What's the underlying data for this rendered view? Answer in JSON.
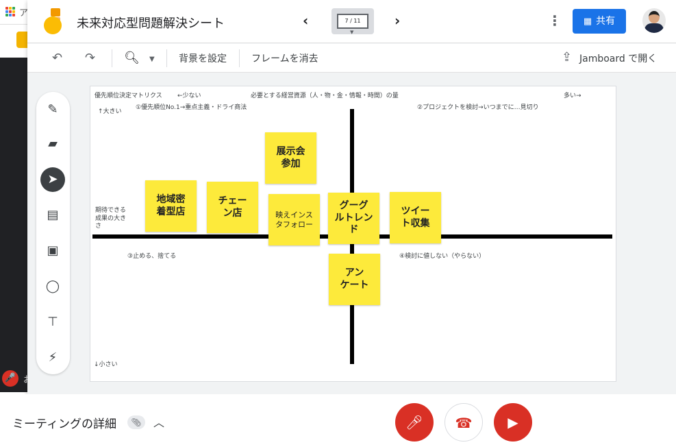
{
  "browser": {
    "tab_char": "ア"
  },
  "meet": {
    "participant_char": "お"
  },
  "jamboard": {
    "title": "未来対応型問題解決シート",
    "frame_counter": "7 / 11",
    "share_label": "共有",
    "toolbar": {
      "set_background": "背景を設定",
      "clear_frame": "フレームを消去",
      "open_in_jamboard": "Jamboard で開く"
    }
  },
  "canvas": {
    "labels": {
      "matrix_title": "優先順位決定マトリクス",
      "less": "←少ない",
      "resources": "必要とする経営資源（人・物・金・情報・時間）の量",
      "more": "多い→",
      "q1": "①優先順位No.1→重点主義・ドライ商法",
      "q2": "②プロジェクトを検討→いつまでに…見切り",
      "large": "↑大きい",
      "expected": "期待できる\n成果の大き\nさ",
      "q3": "③止める、捨てる",
      "q4": "④検討に値しない（やらない）",
      "small": "↓小さい"
    },
    "notes": [
      {
        "text": "地域密\n着型店"
      },
      {
        "text": "チェー\nン店"
      },
      {
        "text": "展示会\n参加"
      },
      {
        "text": "映えインス\nタフォロー"
      },
      {
        "text": "グーグ\nルトレン\nド"
      },
      {
        "text": "ツイー\nト収集"
      },
      {
        "text": "アン\nケート"
      }
    ]
  },
  "bottom": {
    "meeting_details": "ミーティングの詳細"
  },
  "colors": {
    "accent": "#1a73e8",
    "sticky": "#fdea3b",
    "danger": "#d93025"
  }
}
